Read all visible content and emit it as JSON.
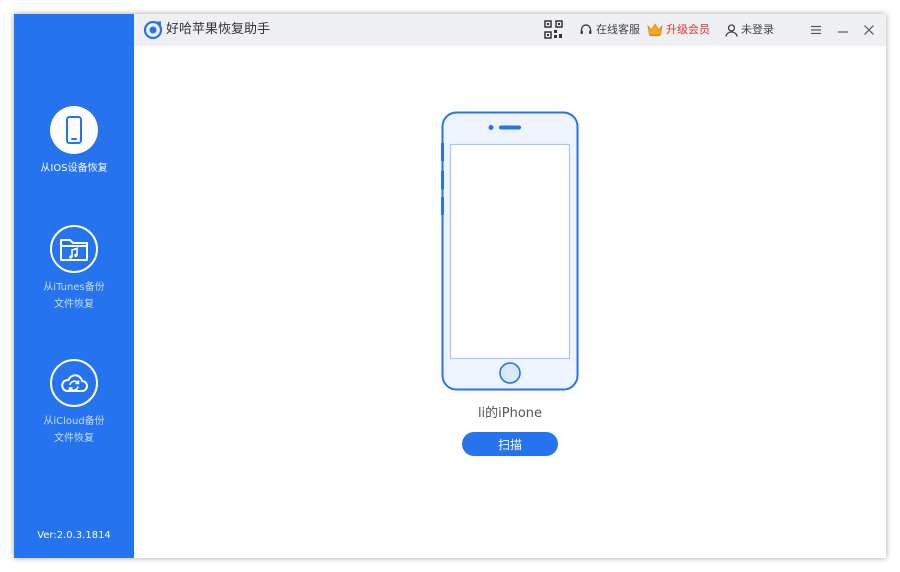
{
  "app": {
    "title": "好哈苹果恢复助手"
  },
  "titlebar": {
    "service_label": "在线客服",
    "upgrade_label": "升级会员",
    "login_label": "未登录"
  },
  "sidebar": {
    "items": [
      {
        "label_line1": "从IOS设备恢复",
        "label_line2": "",
        "icon": "iphone-icon",
        "active": true
      },
      {
        "label_line1": "从iTunes备份",
        "label_line2": "文件恢复",
        "icon": "music-folder-icon",
        "active": false
      },
      {
        "label_line1": "从iCloud备份",
        "label_line2": "文件恢复",
        "icon": "cloud-sync-icon",
        "active": false
      }
    ],
    "version": "Ver:2.0.3.1814"
  },
  "main": {
    "device_name": "li的iPhone",
    "scan_label": "扫描"
  },
  "colors": {
    "accent": "#2573ee",
    "vip": "#e4352b",
    "titlebar_bg": "#eef0f4",
    "phone_fill": "#eef4fd"
  }
}
